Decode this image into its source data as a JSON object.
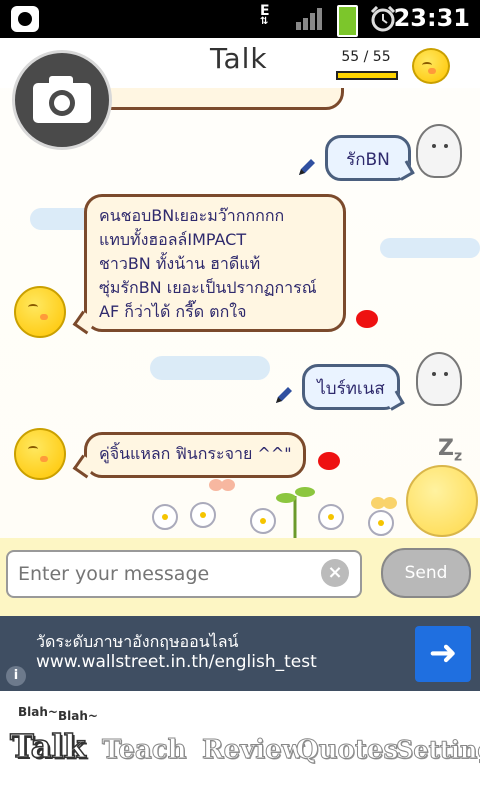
{
  "status_bar": {
    "time": "23:31",
    "network": "E"
  },
  "header": {
    "title": "Talk",
    "counter": "55 / 55"
  },
  "messages": [
    {
      "side": "right",
      "lines": [
        "รักBN"
      ]
    },
    {
      "side": "left",
      "lines": [
        "คนชอบBNเยอะมว๊ากกกกก",
        "แทบทั้งฮอลล์IMPACT",
        "ชาวBN ทั้งน้าน ฮาดีแท้",
        "ซุ่มรักBN เยอะเป็นปรากฏการณ์",
        "AF ก็ว่าได้ กรี๊ด ตกใจ"
      ]
    },
    {
      "side": "right",
      "lines": [
        "ไบร์ทเนส"
      ]
    },
    {
      "side": "left",
      "lines": [
        "คู่จิ้นแหลก ฟินกระจาย ^^\""
      ]
    }
  ],
  "input": {
    "placeholder": "Enter your message",
    "send_label": "Send"
  },
  "ad": {
    "line1": "วัดระดับภาษาอังกฤษออนไลน์",
    "line2": "www.wallstreet.in.th/english_test",
    "info": "i"
  },
  "tabs": {
    "blah1": "Blah~",
    "blah2": "Blah~",
    "items": [
      "Talk",
      "Teach",
      "Review",
      "Quotes",
      "Setting"
    ],
    "active": "Talk"
  }
}
